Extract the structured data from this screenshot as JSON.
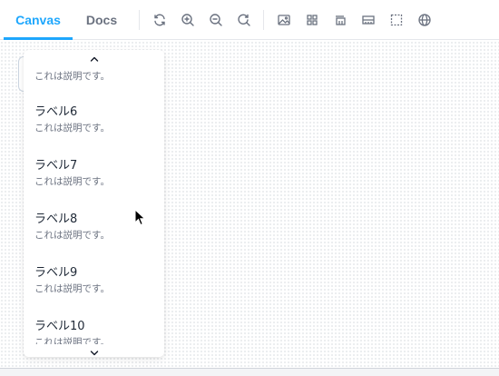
{
  "toolbar": {
    "tabs": [
      {
        "label": "Canvas",
        "active": true
      },
      {
        "label": "Docs",
        "active": false
      }
    ],
    "icons": [
      "sync-icon",
      "zoom-in-icon",
      "zoom-out-icon",
      "zoom-reset-icon",
      "photo-icon",
      "grid-icon",
      "outline-icon",
      "ruler-icon",
      "measure-icon",
      "globe-icon"
    ],
    "accent_color": "#1ea7fd"
  },
  "dropdown": {
    "partial_top_desc": "これは説明です。",
    "items": [
      {
        "label": "ラベル6",
        "description": "これは説明です。"
      },
      {
        "label": "ラベル7",
        "description": "これは説明です。"
      },
      {
        "label": "ラベル8",
        "description": "これは説明です。"
      },
      {
        "label": "ラベル9",
        "description": "これは説明です。"
      },
      {
        "label": "ラベル10",
        "description": "これは説明です。"
      }
    ],
    "scroll_up_icon": "chevron-up-icon",
    "scroll_down_icon": "chevron-down-icon"
  }
}
